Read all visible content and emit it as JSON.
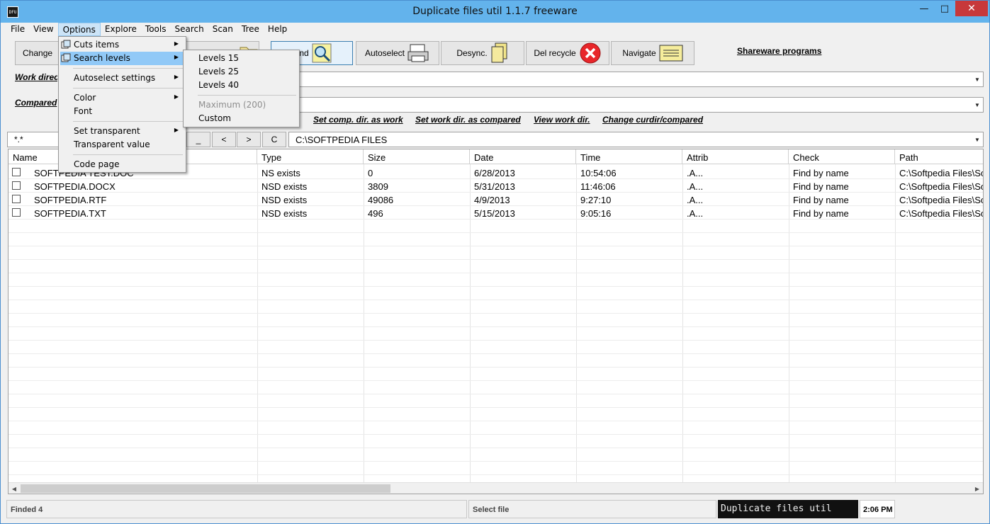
{
  "window": {
    "title": "Duplicate files util 1.1.7 freeware",
    "icon": "DFU",
    "min": "—",
    "max": "□",
    "close": "✕"
  },
  "menubar": [
    "File",
    "View",
    "Options",
    "Explore",
    "Tools",
    "Search",
    "Scan",
    "Tree",
    "Help"
  ],
  "toolbar": {
    "change": "Change",
    "find": "Find",
    "autoselect": "Autoselect",
    "desync": "Desync.",
    "del_recycle": "Del recycle",
    "navigate": "Navigate",
    "shareware": "Shareware programs"
  },
  "labels": {
    "work_dir": "Work directory",
    "compared": "Compared"
  },
  "links": {
    "set_comp": "Set comp. dir. as work",
    "set_work": "Set work dir. as compared",
    "view_work": "View work dir.",
    "change_cur": "Change curdir/compared"
  },
  "filter": {
    "mask": "*.*",
    "btn_up": "_",
    "btn_prev": "<",
    "btn_next": ">",
    "btn_c": "C",
    "path": "C:\\SOFTPEDIA FILES"
  },
  "columns": [
    "Name",
    "Type",
    "Size",
    "Date",
    "Time",
    "Attrib",
    "Check",
    "Path"
  ],
  "rows": [
    {
      "name": "SOFTPEDIA TEST.DOC",
      "type": "NS exists",
      "size": "0",
      "date": "6/28/2013",
      "time": "10:54:06",
      "attrib": ".A...",
      "check": "Find by name",
      "path": "C:\\Softpedia Files\\So"
    },
    {
      "name": "SOFTPEDIA.DOCX",
      "type": "NSD exists",
      "size": "3809",
      "date": "5/31/2013",
      "time": "11:46:06",
      "attrib": ".A...",
      "check": "Find by name",
      "path": "C:\\Softpedia Files\\So"
    },
    {
      "name": "SOFTPEDIA.RTF",
      "type": "NSD exists",
      "size": "49086",
      "date": "4/9/2013",
      "time": " 9:27:10",
      "attrib": ".A...",
      "check": "Find by name",
      "path": "C:\\Softpedia Files\\So"
    },
    {
      "name": "SOFTPEDIA.TXT",
      "type": "NSD exists",
      "size": "496",
      "date": "5/15/2013",
      "time": " 9:05:16",
      "attrib": ".A...",
      "check": "Find by name",
      "path": "C:\\Softpedia Files\\So"
    }
  ],
  "status": {
    "found": "Finded 4",
    "select": "Select file",
    "banner": "Duplicate files util",
    "clock": "2:06 PM"
  },
  "options_menu": {
    "cuts_items": "Cuts items",
    "search_levels": "Search levels",
    "autoselect_settings": "Autoselect settings",
    "color": "Color",
    "font": "Font",
    "set_transparent": "Set transparent",
    "transparent_value": "Transparent value",
    "code_page": "Code page"
  },
  "levels_menu": {
    "l15": "Levels 15",
    "l25": "Levels 25",
    "l40": "Levels 40",
    "maximum": "Maximum (200)",
    "custom": "Custom"
  },
  "colors": {
    "titlebar": "#63b3ec",
    "close": "#c7383a",
    "menu_highlight": "#91c9f7",
    "del_icon": "#e8262a"
  }
}
